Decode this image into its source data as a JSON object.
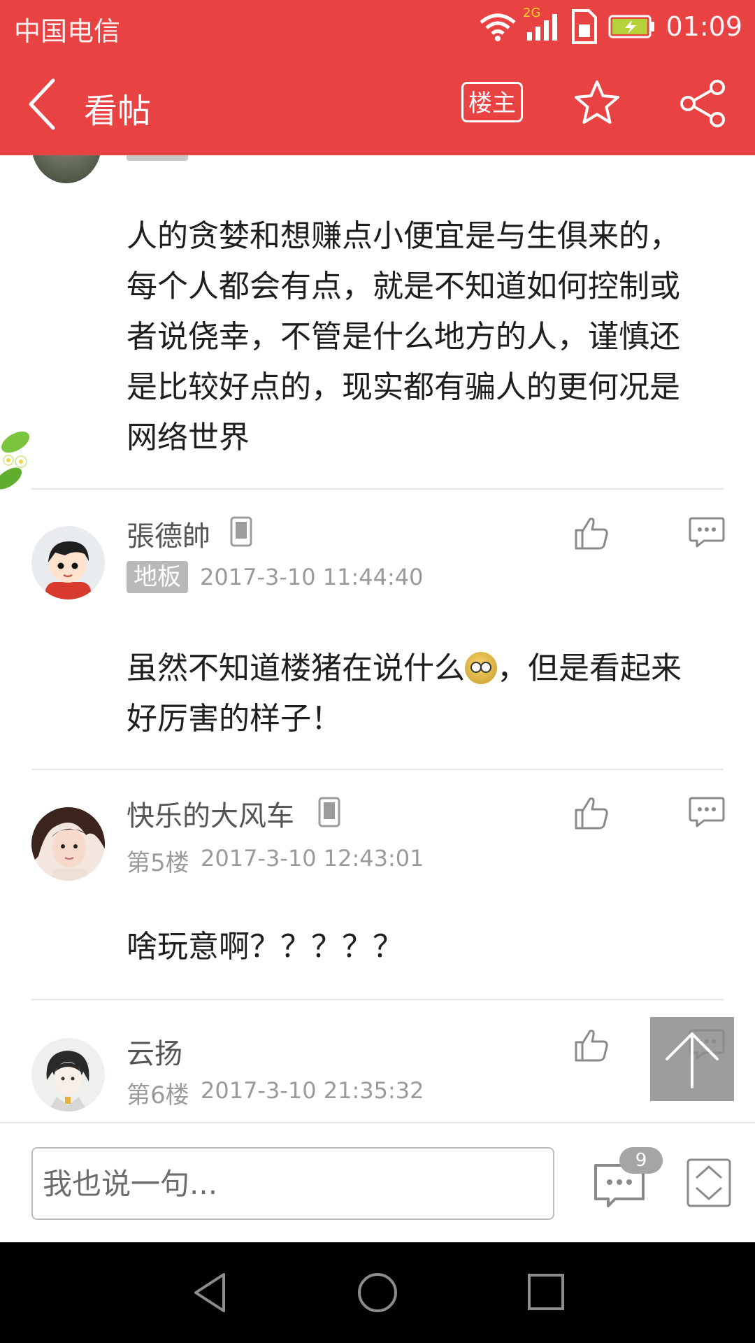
{
  "status_bar": {
    "carrier": "中国电信",
    "network_type": "2G",
    "time": "01:09",
    "icons": [
      "wifi-icon",
      "signal-icon",
      "sim-icon",
      "battery-icon"
    ]
  },
  "title_bar": {
    "title": "看帖",
    "op_only_label": "楼主",
    "icons": [
      "back-arrow-icon",
      "star-icon",
      "share-icon"
    ]
  },
  "posts": [
    {
      "text": "人的贪婪和想赚点小便宜是与生俱来的，每个人都会有点，就是不知道如何控制或者说侥幸，不管是什么地方的人，谨慎还是比较好点的，现实都有骗人的更何况是网络世界"
    },
    {
      "username": "張德帥",
      "floor": "地板",
      "time": "2017-3-10 11:44:40",
      "text_before_emoji": "虽然不知道楼猪在说什么",
      "emoji": "dizzy-face-emoji",
      "text_after_emoji": "，但是看起来好厉害的样子！",
      "has_mobile_icon": true
    },
    {
      "username": "快乐的大风车",
      "floor": "第5楼",
      "time": "2017-3-10 12:43:01",
      "text": "啥玩意啊？？？？？",
      "has_mobile_icon": true
    },
    {
      "username": "云扬",
      "floor": "第6楼",
      "time": "2017-3-10 21:35:32"
    }
  ],
  "input_bar": {
    "placeholder": "我也说一句...",
    "comment_count": "9"
  },
  "colors": {
    "brand_red": "#e94242",
    "badge_gray": "#b9b9b9",
    "meta_gray": "#9a9a9a"
  }
}
